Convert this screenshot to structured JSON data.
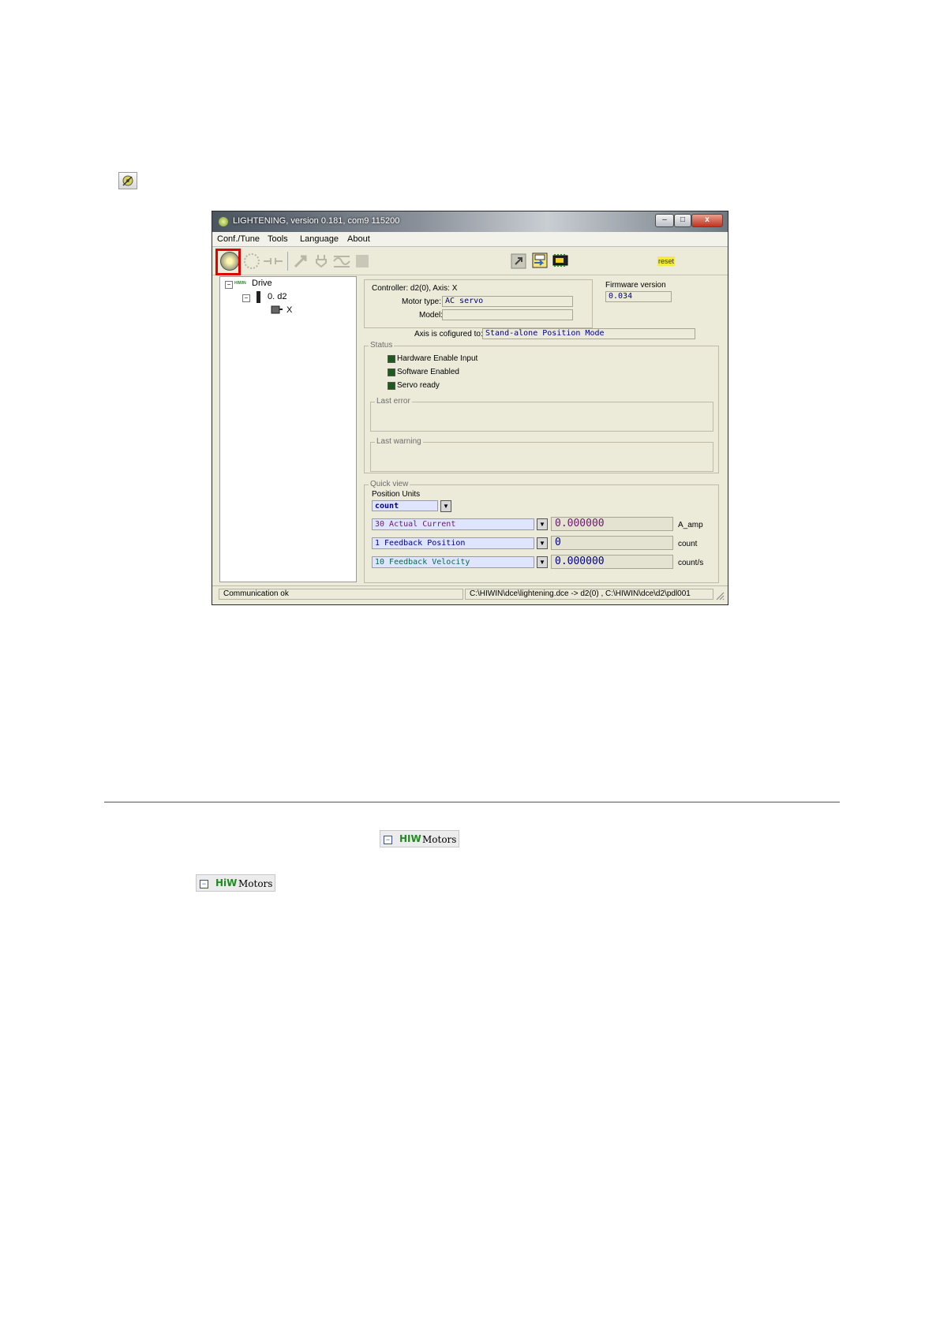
{
  "window": {
    "title": "LIGHTENING, version 0.181, com9 115200",
    "controls": {
      "minimize": "–",
      "maximize": "□",
      "close": "x"
    }
  },
  "menu": [
    "Conf./Tune",
    "Tools",
    "Language",
    "About"
  ],
  "toolbar": {
    "reset_label": "reset"
  },
  "tree": {
    "root": "Drive",
    "root_prefix": "HIWIN",
    "node": "0. d2",
    "axis": "X"
  },
  "controller_info": {
    "controller_label": "Controller: d2(0),  Axis: X",
    "motor_type_label": "Motor type:",
    "motor_type_value": "AC servo",
    "model_label": "Model:",
    "model_value": "",
    "firmware_label": "Firmware version",
    "firmware_value": "0.034",
    "axis_config_label": "Axis is cofigured to:",
    "axis_config_value": "Stand-alone Position Mode"
  },
  "status": {
    "group_label": "Status",
    "items": [
      "Hardware Enable Input",
      "Software Enabled",
      "Servo ready"
    ],
    "last_error_label": "Last error",
    "last_warning_label": "Last warning"
  },
  "quick_view": {
    "group_label": "Quick view",
    "position_units_label": "Position Units",
    "position_units_value": "count",
    "rows": [
      {
        "channel": "30 Actual Current",
        "value": "0.000000",
        "unit": "A_amp",
        "color": "#6a1a6a"
      },
      {
        "channel": " 1 Feedback Position",
        "value": "0",
        "unit": "count",
        "color": "#000090"
      },
      {
        "channel": "10 Feedback Velocity",
        "value": "0.000000",
        "unit": "count/s",
        "color": "#0a6a4a"
      }
    ]
  },
  "statusbar": {
    "left": "Communication ok",
    "right": "C:\\HIWIN\\dce\\lightening.dce -> d2(0) , C:\\HIWIN\\dce\\d2\\pdl001"
  },
  "chips": [
    {
      "hiw": "HIW",
      "label": "Motors"
    },
    {
      "hiw": "HiW",
      "label": "Motors"
    }
  ]
}
